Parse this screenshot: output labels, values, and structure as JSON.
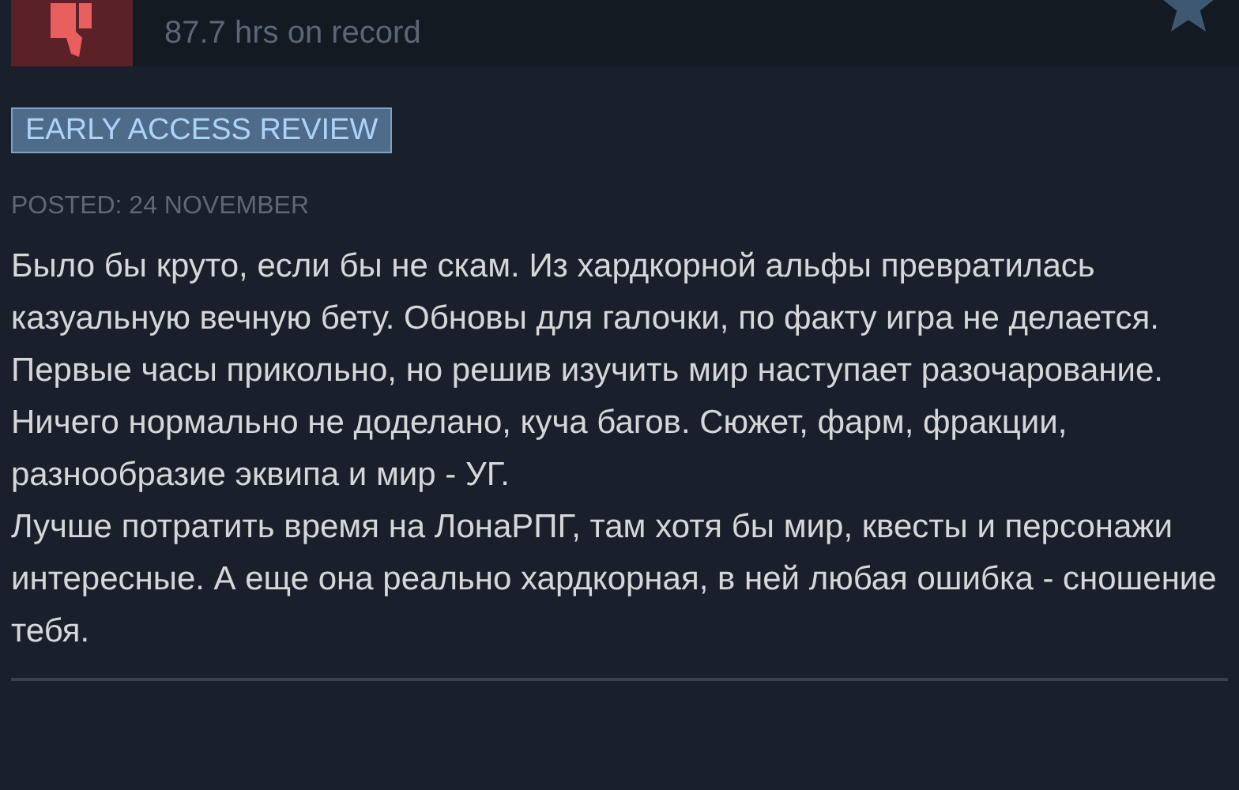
{
  "header": {
    "recommended": false,
    "hours": "87.7 hrs on record"
  },
  "badge": "EARLY ACCESS REVIEW",
  "posted": "POSTED: 24 NOVEMBER",
  "paragraphs": [
    "Было бы круто, если бы не скам. Из хардкорной альфы превратилась казуальную вечную бету. Обновы для галочки, по факту игра не делается. Первые часы прикольно, но решив изучить мир наступает разочарование. Ничего нормально не доделано, куча багов. Сюжет, фарм, фракции, разнообразие эквипа и мир - УГ.",
    "Лучше потратить время на ЛонаРПГ, там хотя бы мир, квесты и персонажи интересные. А еще она реально хардкорная, в ней любая ошибка - сношение тебя."
  ]
}
